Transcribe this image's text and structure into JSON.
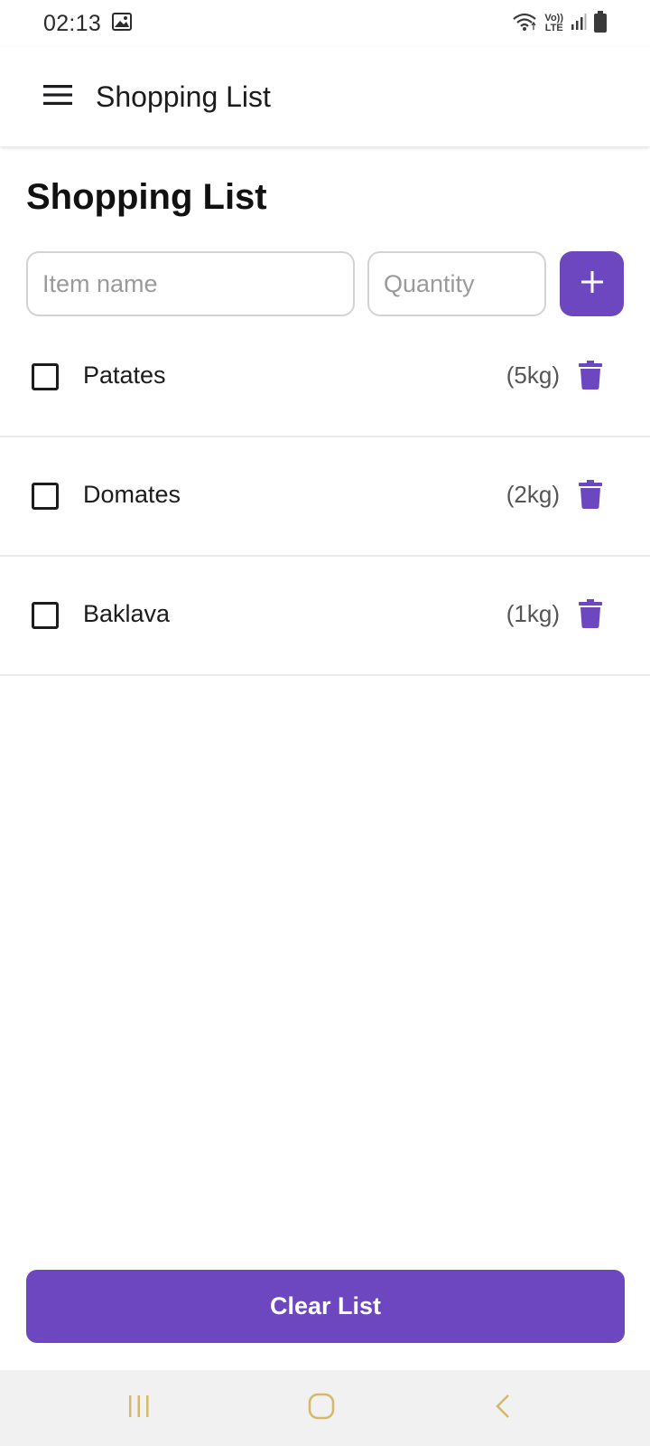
{
  "status_bar": {
    "time": "02:13",
    "lte_top": "Vo))",
    "lte_bottom": "LTE"
  },
  "app_bar": {
    "title": "Shopping List"
  },
  "page": {
    "title": "Shopping List"
  },
  "add_form": {
    "item_placeholder": "Item name",
    "item_value": "",
    "quantity_placeholder": "Quantity",
    "quantity_value": ""
  },
  "items": [
    {
      "name": "Patates",
      "quantity": "(5kg)",
      "checked": false
    },
    {
      "name": "Domates",
      "quantity": "(2kg)",
      "checked": false
    },
    {
      "name": "Baklava",
      "quantity": "(1kg)",
      "checked": false
    }
  ],
  "footer": {
    "clear_label": "Clear List"
  },
  "colors": {
    "accent": "#6d47c0",
    "divider": "#ebebeb",
    "nav_bar": "#f1f1f1",
    "nav_icons": "#d4b96a"
  },
  "icons": {
    "status_image": "image-icon",
    "wifi": "wifi-icon",
    "signal": "signal-icon",
    "battery": "battery-icon",
    "menu": "hamburger-menu-icon",
    "add": "plus-icon",
    "delete": "trash-icon",
    "nav_recents": "recents-icon",
    "nav_home": "home-icon",
    "nav_back": "back-icon"
  }
}
